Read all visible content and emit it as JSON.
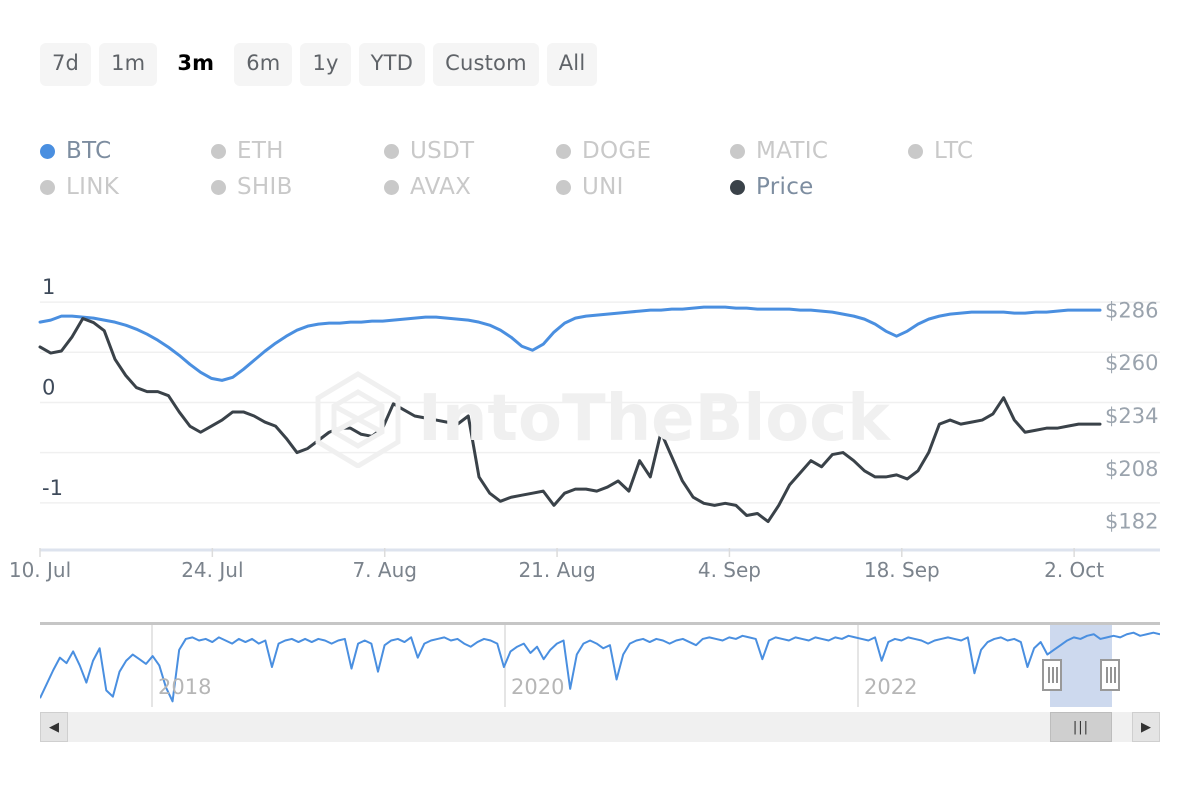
{
  "timeframes": [
    {
      "label": "7d",
      "active": false
    },
    {
      "label": "1m",
      "active": false
    },
    {
      "label": "3m",
      "active": true
    },
    {
      "label": "6m",
      "active": false
    },
    {
      "label": "1y",
      "active": false
    },
    {
      "label": "YTD",
      "active": false
    },
    {
      "label": "Custom",
      "active": false
    },
    {
      "label": "All",
      "active": false
    }
  ],
  "legend": [
    {
      "label": "BTC",
      "active": true,
      "color": "#4a8fe0"
    },
    {
      "label": "ETH",
      "active": false,
      "color": "#c9c9c9"
    },
    {
      "label": "USDT",
      "active": false,
      "color": "#c9c9c9"
    },
    {
      "label": "DOGE",
      "active": false,
      "color": "#c9c9c9"
    },
    {
      "label": "MATIC",
      "active": false,
      "color": "#c9c9c9"
    },
    {
      "label": "LTC",
      "active": false,
      "color": "#c9c9c9"
    },
    {
      "label": "LINK",
      "active": false,
      "color": "#c9c9c9"
    },
    {
      "label": "SHIB",
      "active": false,
      "color": "#c9c9c9"
    },
    {
      "label": "AVAX",
      "active": false,
      "color": "#c9c9c9"
    },
    {
      "label": "UNI",
      "active": false,
      "color": "#c9c9c9"
    },
    {
      "label": "Price",
      "active": true,
      "color": "#3a4249"
    }
  ],
  "watermark": {
    "text": "IntoTheBlock"
  },
  "navigator": {
    "years": [
      "2018",
      "2020",
      "2022"
    ],
    "selection_color": "#cdd9ee",
    "series_color": "#4a8fe0"
  },
  "scrollbar": {
    "left_arrow": "◀",
    "right_arrow": "▶",
    "grip": "|||"
  },
  "chart_data": {
    "type": "line",
    "title": "",
    "xlabel": "",
    "ylabel": "",
    "grid": true,
    "legend_position": "top",
    "x_tick_labels": [
      "10. Jul",
      "24. Jul",
      "7. Aug",
      "21. Aug",
      "4. Sep",
      "18. Sep",
      "2. Oct"
    ],
    "x_tick_positions": [
      0.0,
      0.1626,
      0.3252,
      0.4878,
      0.6504,
      0.813,
      0.9756
    ],
    "left_axis": {
      "tick_labels": [
        "1",
        "0",
        "-1"
      ],
      "tick_values": [
        1,
        0,
        -1
      ],
      "ylim": [
        -1.45,
        1.18
      ],
      "color": "#3e4a5a"
    },
    "right_axis": {
      "tick_labels": [
        "$286",
        "$260",
        "$234",
        "$208",
        "$182"
      ],
      "tick_values": [
        286,
        260,
        234,
        208,
        182
      ],
      "ylim": [
        169,
        299
      ],
      "color": "#9aa3ad"
    },
    "gridline_values_left": [
      1.0,
      0.5,
      0.0,
      -0.5,
      -1.0
    ],
    "series": [
      {
        "name": "BTC",
        "axis": "left",
        "color": "#4a8fe0",
        "width": 3,
        "values": [
          0.8,
          0.82,
          0.86,
          0.86,
          0.85,
          0.84,
          0.82,
          0.8,
          0.77,
          0.73,
          0.68,
          0.62,
          0.55,
          0.47,
          0.38,
          0.3,
          0.24,
          0.22,
          0.25,
          0.33,
          0.42,
          0.51,
          0.59,
          0.66,
          0.72,
          0.76,
          0.78,
          0.79,
          0.79,
          0.8,
          0.8,
          0.81,
          0.81,
          0.82,
          0.83,
          0.84,
          0.85,
          0.85,
          0.84,
          0.83,
          0.82,
          0.8,
          0.77,
          0.72,
          0.65,
          0.56,
          0.52,
          0.58,
          0.7,
          0.79,
          0.84,
          0.86,
          0.87,
          0.88,
          0.89,
          0.9,
          0.91,
          0.92,
          0.92,
          0.93,
          0.93,
          0.94,
          0.95,
          0.95,
          0.95,
          0.94,
          0.94,
          0.93,
          0.93,
          0.93,
          0.93,
          0.92,
          0.92,
          0.91,
          0.9,
          0.88,
          0.86,
          0.83,
          0.78,
          0.71,
          0.66,
          0.71,
          0.78,
          0.83,
          0.86,
          0.88,
          0.89,
          0.9,
          0.9,
          0.9,
          0.9,
          0.89,
          0.89,
          0.9,
          0.9,
          0.91,
          0.92,
          0.92,
          0.92,
          0.92
        ]
      },
      {
        "name": "Price",
        "axis": "right",
        "color": "#3a4249",
        "width": 3,
        "values": [
          268,
          265,
          266,
          273,
          282,
          280,
          276,
          262,
          254,
          248,
          246,
          246,
          244,
          236,
          229,
          226,
          229,
          232,
          236,
          236,
          234,
          231,
          229,
          223,
          216,
          218,
          222,
          226,
          228,
          228,
          225,
          224,
          228,
          240,
          237,
          234,
          233,
          232,
          231,
          230,
          234,
          204,
          196,
          192,
          194,
          195,
          196,
          197,
          190,
          196,
          198,
          198,
          197,
          199,
          202,
          197,
          212,
          204,
          226,
          214,
          202,
          194,
          191,
          190,
          191,
          190,
          185,
          186,
          182,
          190,
          200,
          206,
          212,
          209,
          215,
          216,
          212,
          207,
          204,
          204,
          205,
          203,
          207,
          216,
          230,
          232,
          230,
          231,
          232,
          235,
          243,
          232,
          226,
          227,
          228,
          228,
          229,
          230,
          230,
          230
        ]
      }
    ]
  },
  "navigator_data": {
    "type": "line",
    "series": [
      0.1,
      0.28,
      0.46,
      0.62,
      0.55,
      0.7,
      0.52,
      0.3,
      0.58,
      0.74,
      0.2,
      0.12,
      0.44,
      0.58,
      0.66,
      0.6,
      0.54,
      0.64,
      0.52,
      0.24,
      0.06,
      0.72,
      0.86,
      0.88,
      0.84,
      0.86,
      0.82,
      0.88,
      0.84,
      0.8,
      0.86,
      0.82,
      0.86,
      0.8,
      0.84,
      0.5,
      0.8,
      0.84,
      0.86,
      0.82,
      0.86,
      0.82,
      0.86,
      0.84,
      0.8,
      0.84,
      0.86,
      0.48,
      0.8,
      0.84,
      0.8,
      0.44,
      0.78,
      0.84,
      0.86,
      0.82,
      0.88,
      0.62,
      0.8,
      0.84,
      0.86,
      0.88,
      0.84,
      0.86,
      0.8,
      0.76,
      0.82,
      0.86,
      0.84,
      0.8,
      0.5,
      0.7,
      0.76,
      0.8,
      0.68,
      0.76,
      0.6,
      0.72,
      0.8,
      0.84,
      0.22,
      0.66,
      0.8,
      0.84,
      0.8,
      0.74,
      0.78,
      0.34,
      0.66,
      0.8,
      0.84,
      0.86,
      0.82,
      0.86,
      0.84,
      0.8,
      0.84,
      0.86,
      0.82,
      0.78,
      0.86,
      0.88,
      0.86,
      0.84,
      0.88,
      0.86,
      0.9,
      0.88,
      0.86,
      0.6,
      0.84,
      0.88,
      0.86,
      0.84,
      0.88,
      0.86,
      0.84,
      0.88,
      0.86,
      0.84,
      0.88,
      0.86,
      0.9,
      0.88,
      0.86,
      0.84,
      0.88,
      0.58,
      0.82,
      0.86,
      0.84,
      0.88,
      0.86,
      0.84,
      0.8,
      0.84,
      0.86,
      0.88,
      0.86,
      0.84,
      0.88,
      0.42,
      0.72,
      0.82,
      0.86,
      0.88,
      0.84,
      0.86,
      0.82,
      0.5,
      0.74,
      0.82,
      0.66,
      0.72,
      0.78,
      0.84,
      0.88,
      0.86,
      0.9,
      0.92,
      0.86,
      0.88,
      0.9,
      0.88,
      0.92,
      0.94,
      0.9,
      0.92,
      0.94,
      0.92
    ]
  }
}
